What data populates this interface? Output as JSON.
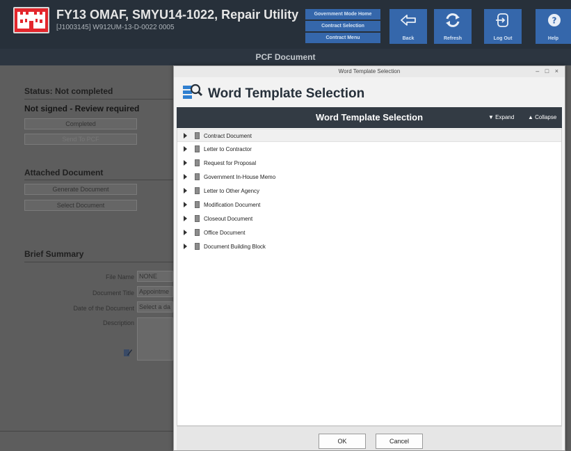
{
  "header": {
    "title": "FY13 OMAF, SMYU14-1022, Repair Utility",
    "subtitle": "[J1003145] W912UM-13-D-0022 0005",
    "small_buttons": [
      "Government Mode Home",
      "Contract Selection",
      "Contract Menu"
    ],
    "buttons": [
      {
        "label": "Back",
        "icon": "back-arrow-icon"
      },
      {
        "label": "Refresh",
        "icon": "refresh-icon"
      },
      {
        "label": "Log Out",
        "icon": "logout-icon"
      },
      {
        "label": "Help",
        "icon": "help-icon"
      }
    ]
  },
  "page_title": "PCF Document",
  "background_panel": {
    "status": "Status: Not completed",
    "signed_state": "Not signed - Review required",
    "completed_button": "Completed",
    "send_button": "Send To PCF",
    "attached_heading": "Attached Document",
    "generate_button": "Generate Document",
    "select_button": "Select Document",
    "summary_heading": "Brief Summary",
    "fields": [
      {
        "label": "File Name",
        "value": "NONE"
      },
      {
        "label": "Document Title",
        "value": "Appointme"
      },
      {
        "label": "Date of the Document",
        "value": "Select a da"
      },
      {
        "label": "Description",
        "value": ""
      }
    ]
  },
  "modal": {
    "window_title": "Word Template Selection",
    "heading": "Word Template Selection",
    "bar_title": "Word Template Selection",
    "expand_label": "Expand",
    "collapse_label": "Collapse",
    "window_controls": "– □ ×",
    "items": [
      "Contract Document",
      "Letter to Contractor",
      "Request for Proposal",
      "Government In-House Memo",
      "Letter to Other Agency",
      "Modification Document",
      "Closeout Document",
      "Office Document",
      "Document Building Block"
    ],
    "ok_label": "OK",
    "cancel_label": "Cancel"
  },
  "colors": {
    "header_bg": "#27303a",
    "accent_blue": "#3567ab",
    "logo_red": "#e3262c",
    "modal_bar": "#333b44"
  }
}
